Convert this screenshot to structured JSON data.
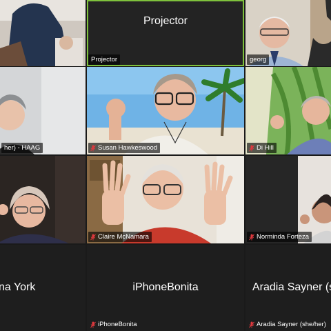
{
  "tiles": {
    "t1": {
      "name": ""
    },
    "projector": {
      "name": "Projector",
      "label": "Projector"
    },
    "georg": {
      "name": "georg"
    },
    "haag": {
      "name": "her) - HAAG"
    },
    "susan": {
      "name": "Susan Hawkeswood"
    },
    "di": {
      "name": "Di Hill"
    },
    "t7": {
      "name": ""
    },
    "claire": {
      "name": "Claire McNamara"
    },
    "norminda": {
      "name": "Norminda Forteza"
    },
    "york": {
      "center": "na York"
    },
    "iphone": {
      "center": "iPhoneBonita",
      "name": "iPhoneBonita"
    },
    "aradia": {
      "center": "Aradia Sayner (sh",
      "name": "Aradia Sayner (she/her)"
    }
  },
  "colors": {
    "active_border": "#7ec13c",
    "muted_mic": "#e0393e",
    "tile_bg": "#242424"
  }
}
